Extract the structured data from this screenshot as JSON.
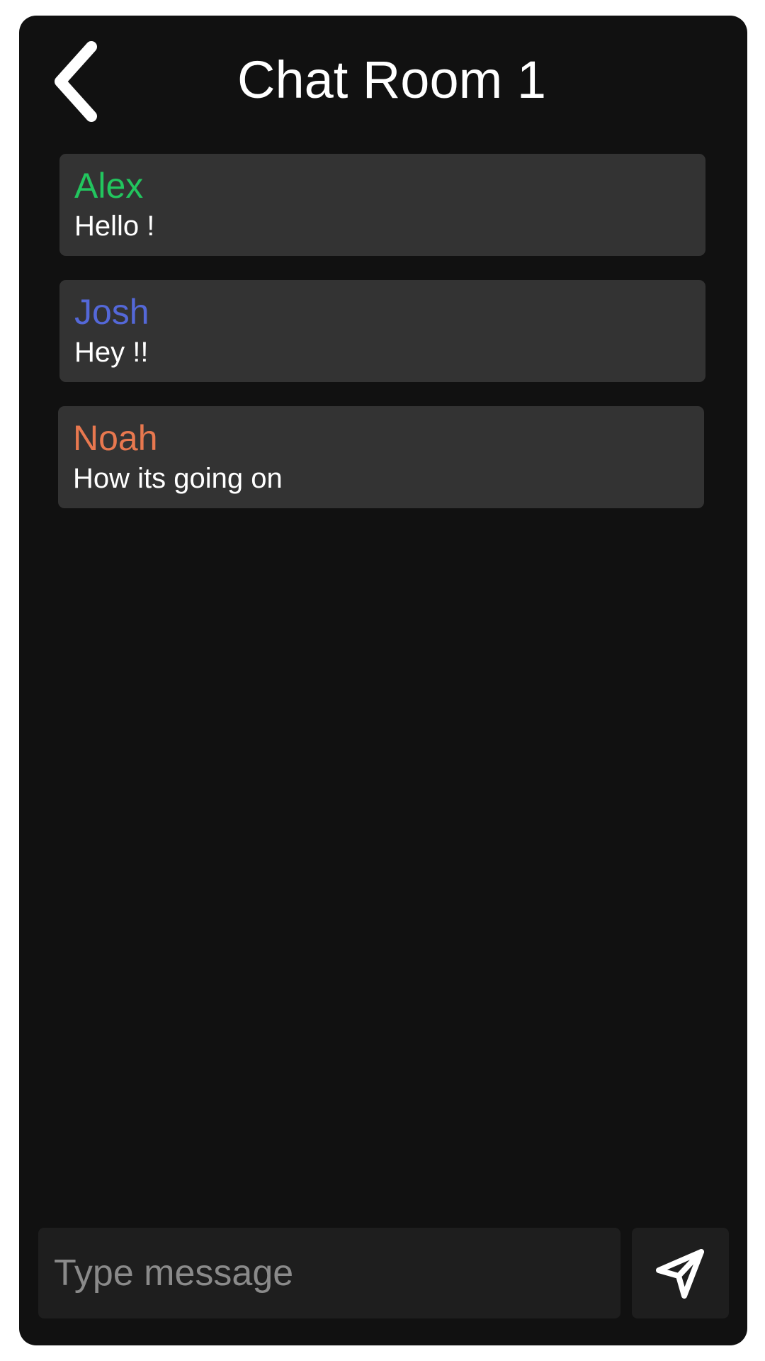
{
  "header": {
    "title": "Chat Room 1",
    "back_icon": "chevron-left-icon"
  },
  "messages": [
    {
      "sender": "Alex",
      "text": "Hello !",
      "sender_color": "#22c55e"
    },
    {
      "sender": "Josh",
      "text": "Hey !!",
      "sender_color": "#5468d8"
    },
    {
      "sender": "Noah",
      "text": "How its going on",
      "sender_color": "#e8784f"
    }
  ],
  "composer": {
    "placeholder": "Type message",
    "value": "",
    "send_icon": "send-arrow-icon"
  },
  "colors": {
    "background": "#111111",
    "bubble": "#333333",
    "input": "#1e1e1e"
  }
}
